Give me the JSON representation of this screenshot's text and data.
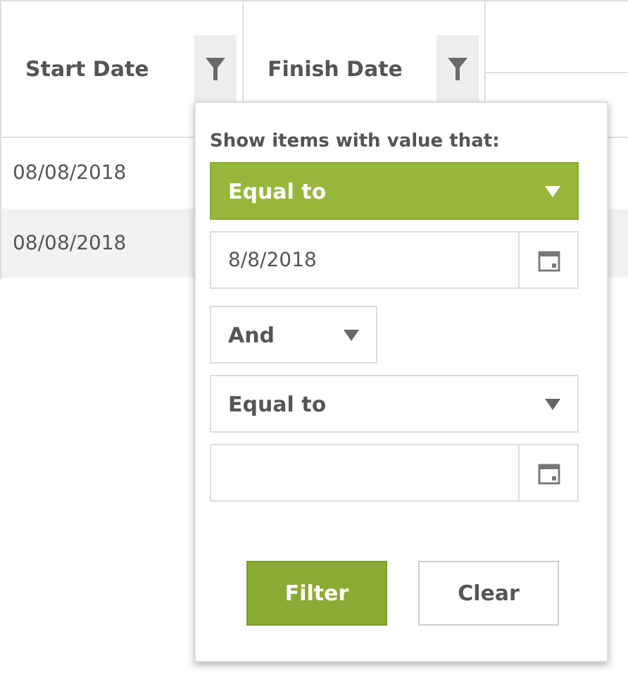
{
  "table": {
    "columns": [
      {
        "label": "Start Date",
        "filter_active": true
      },
      {
        "label": "Finish Date",
        "filter_active": true
      },
      {
        "kind": "group"
      }
    ],
    "rows": [
      {
        "cells": [
          "08/08/2018"
        ],
        "selected": false
      },
      {
        "cells": [
          "08/08/2018"
        ],
        "selected": true
      }
    ]
  },
  "filter_popup": {
    "prompt": "Show items with value that:",
    "first_operator": "Equal to",
    "first_value": "8/8/2018",
    "logic": "And",
    "second_operator": "Equal to",
    "buttons": [
      {
        "label": "Filter",
        "primary": true
      },
      {
        "label": "Clear",
        "primary": false
      }
    ]
  }
}
